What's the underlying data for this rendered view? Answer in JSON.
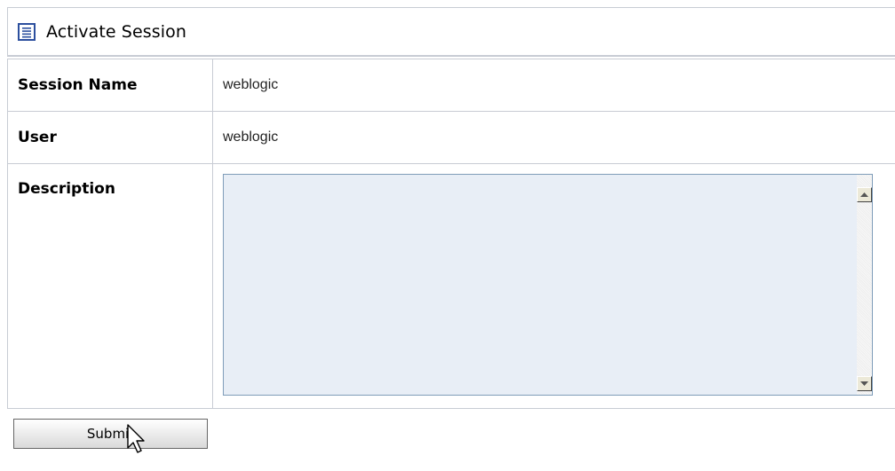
{
  "panel": {
    "title": "Activate Session",
    "icon": "list-icon"
  },
  "form": {
    "session_name_label": "Session Name",
    "session_name_value": "weblogic",
    "user_label": "User",
    "user_value": "weblogic",
    "description_label": "Description",
    "description_value": ""
  },
  "actions": {
    "submit_label": "Submit"
  },
  "colors": {
    "border": "#c8ccd4",
    "textarea_bg": "#e8eef6",
    "textarea_border": "#7f9db9"
  }
}
